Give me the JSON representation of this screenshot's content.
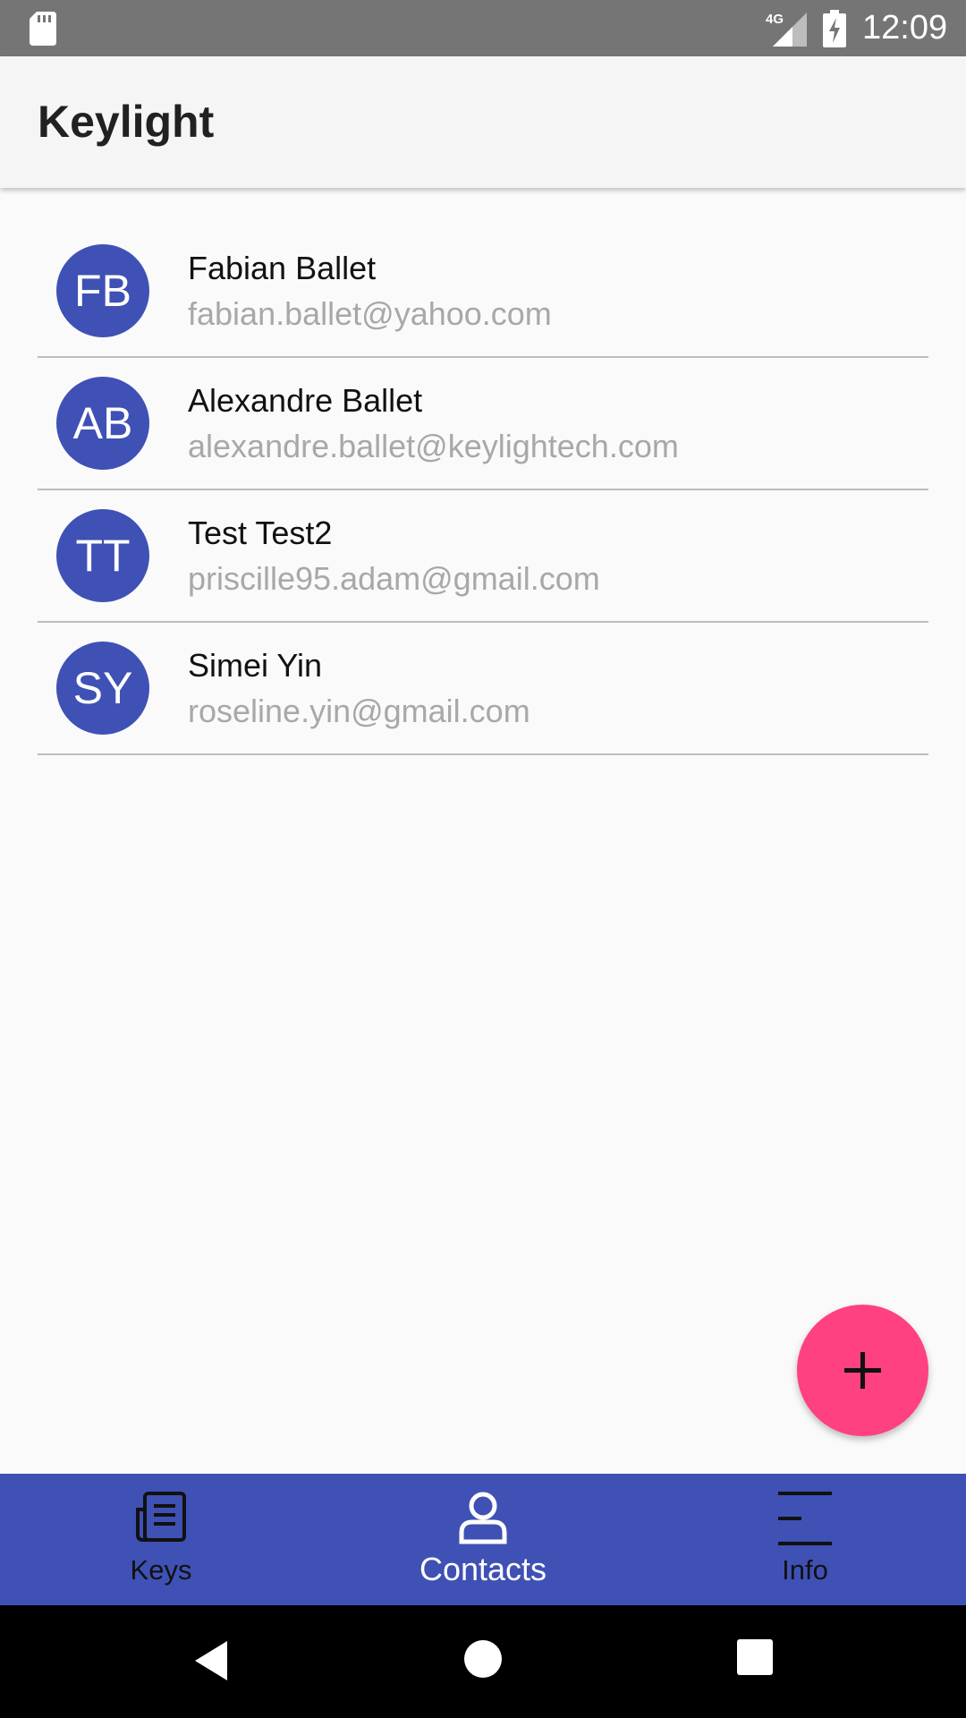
{
  "status_bar": {
    "time": "12:09",
    "network": "4G",
    "icons": [
      "sd-card-icon",
      "cellular-signal-icon",
      "battery-charging-icon"
    ]
  },
  "app_bar": {
    "title": "Keylight"
  },
  "contacts": [
    {
      "initials": "FB",
      "name": "Fabian Ballet",
      "email": "fabian.ballet@yahoo.com"
    },
    {
      "initials": "AB",
      "name": "Alexandre Ballet",
      "email": "alexandre.ballet@keylightech.com"
    },
    {
      "initials": "TT",
      "name": "Test Test2",
      "email": "priscille95.adam@gmail.com"
    },
    {
      "initials": "SY",
      "name": "Simei Yin",
      "email": "roseline.yin@gmail.com"
    }
  ],
  "fab": {
    "icon": "plus-icon"
  },
  "bottom_nav": {
    "active": "Contacts",
    "tabs": [
      {
        "label": "Keys",
        "icon": "keys-icon"
      },
      {
        "label": "Contacts",
        "icon": "person-icon"
      },
      {
        "label": "Info",
        "icon": "menu-lines-icon"
      }
    ]
  },
  "system_nav": {
    "icons": [
      "back-icon",
      "home-icon",
      "recents-icon"
    ]
  },
  "colors": {
    "primary": "#3f51b5",
    "accent": "#ff4081",
    "status_bar": "#757575",
    "app_bar": "#f5f5f5",
    "secondary_text": "#a8a8a8"
  }
}
